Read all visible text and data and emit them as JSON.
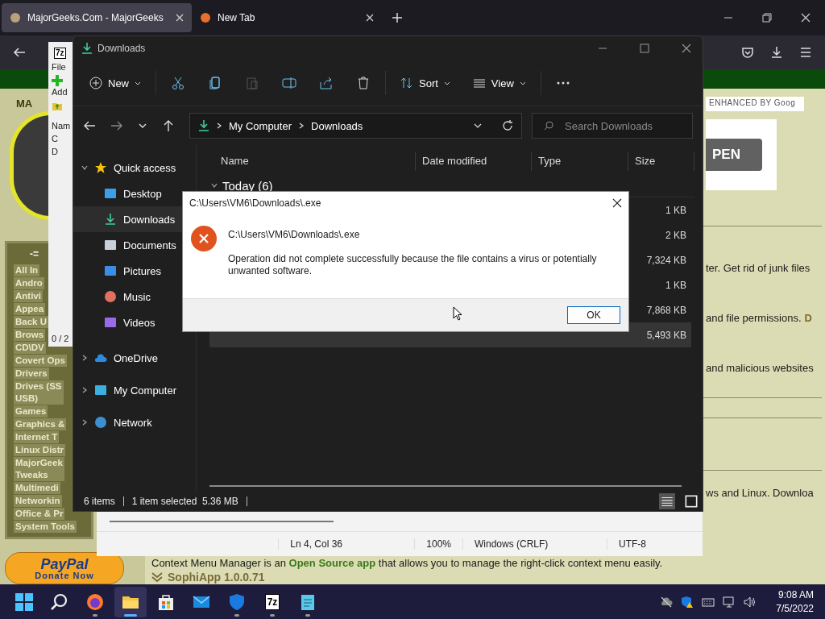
{
  "browser": {
    "tabs": [
      {
        "label": "MajorGeeks.Com - MajorGeeks",
        "selected": true
      },
      {
        "label": "New Tab",
        "selected": false
      }
    ]
  },
  "website": {
    "logo_text": "MA",
    "search_placeholder": "ENHANCED BY Goog",
    "banner_button": "PEN",
    "sidebar_header": "-=",
    "categories": [
      "All In",
      "Andro",
      "Antivi",
      "Appea",
      "Back U",
      "Brows",
      "CD\\DV",
      "Covert Ops",
      "Drivers",
      "Drives (SS\nUSB)",
      "Games",
      "Graphics &",
      "Internet T",
      "Linux Distr",
      "MajorGeek\nTweaks",
      "Multimedi",
      "Networkin",
      "Office & Pr",
      "System Tools"
    ],
    "fragments": [
      {
        "text": "ter. Get rid of junk files"
      },
      {
        "text": "and file permissions.",
        "link": "D"
      },
      {
        "text": "and malicious websites"
      }
    ],
    "fragment_low": "ws and Linux. Downloa",
    "paypal": {
      "logo": "PayPal",
      "label": "Donate Now"
    },
    "article_text": "Context Menu Manager is an **Open Source app** that allows you to manage the right-click context menu easily.",
    "article_title": "SophiApp 1.0.0.71"
  },
  "sevenzip": {
    "title_icon": "7z",
    "menu": "File",
    "add": "Add",
    "column": "Nam",
    "rows": [
      "C",
      "D"
    ],
    "status": "0 / 2"
  },
  "notepad": {
    "status": [
      "Ln 4, Col 36",
      "100%",
      "Windows (CRLF)",
      "UTF-8"
    ]
  },
  "explorer": {
    "title": "Downloads",
    "toolbar": {
      "new": "New",
      "sort": "Sort",
      "view": "View"
    },
    "breadcrumb": [
      "My Computer",
      "Downloads"
    ],
    "search_placeholder": "Search Downloads",
    "nav": [
      {
        "label": "Quick access",
        "kind": "section",
        "selected": false
      },
      {
        "label": "Desktop",
        "kind": "item",
        "selected": false
      },
      {
        "label": "Downloads",
        "kind": "item",
        "selected": true
      },
      {
        "label": "Documents",
        "kind": "item",
        "selected": false
      },
      {
        "label": "Pictures",
        "kind": "item",
        "selected": false
      },
      {
        "label": "Music",
        "kind": "item",
        "selected": false
      },
      {
        "label": "Videos",
        "kind": "item",
        "selected": false
      },
      {
        "label": "OneDrive",
        "kind": "section",
        "selected": false
      },
      {
        "label": "My Computer",
        "kind": "section",
        "selected": false
      },
      {
        "label": "Network",
        "kind": "section",
        "selected": false
      }
    ],
    "columns": [
      "Name",
      "Date modified",
      "Type",
      "Size"
    ],
    "group": "Today (6)",
    "files": [
      {
        "size": "1 KB",
        "selected": false
      },
      {
        "size": "2 KB",
        "selected": false
      },
      {
        "size": "7,324 KB",
        "selected": false
      },
      {
        "size": "1 KB",
        "selected": false
      },
      {
        "size": "7,868 KB",
        "selected": false
      },
      {
        "size": "5,493 KB",
        "selected": true
      }
    ],
    "status": {
      "count": "6 items",
      "selection": "1 item selected  5.36 MB"
    }
  },
  "dialog": {
    "title": "C:\\Users\\VM6\\Downloads\\.exe",
    "heading": "C:\\Users\\VM6\\Downloads\\.exe",
    "message": "Operation did not complete successfully because the file contains a virus or potentially unwanted software.",
    "button": "OK"
  },
  "taskbar": {
    "apps": [
      {
        "kind": "start",
        "running": false,
        "selected": false
      },
      {
        "kind": "search",
        "running": false,
        "selected": false
      },
      {
        "kind": "firefox",
        "running": true,
        "selected": false
      },
      {
        "kind": "explorer",
        "running": true,
        "selected": true
      },
      {
        "kind": "store",
        "running": false,
        "selected": false
      },
      {
        "kind": "mail",
        "running": false,
        "selected": false
      },
      {
        "kind": "shield",
        "running": true,
        "selected": false
      },
      {
        "kind": "sevenzip",
        "running": true,
        "selected": false,
        "label": "7z"
      },
      {
        "kind": "notepad",
        "running": true,
        "selected": false
      }
    ],
    "time": "9:08 AM",
    "date": "7/5/2022"
  }
}
